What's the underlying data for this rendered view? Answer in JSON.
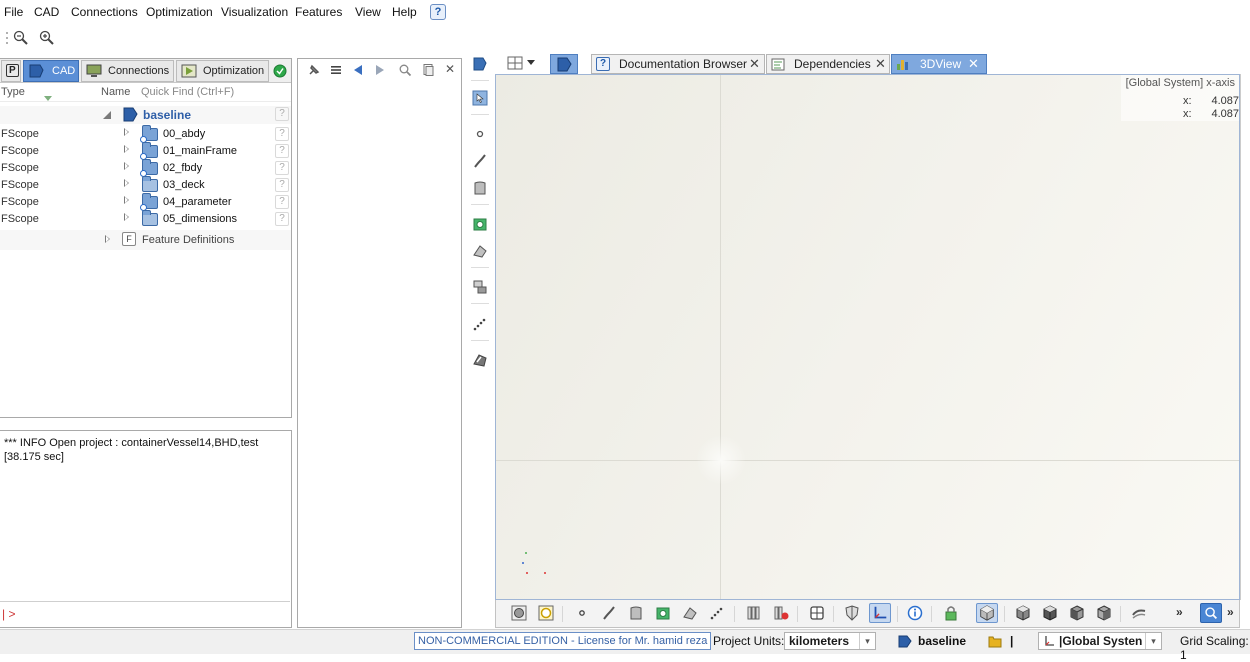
{
  "menu": [
    "File",
    "CAD",
    "Connections",
    "Optimization",
    "Visualization",
    "Features",
    "View",
    "Help"
  ],
  "help_icon_label": "?",
  "left_tabs": [
    {
      "label": "P"
    },
    {
      "label": "CAD"
    },
    {
      "label": "Connections"
    },
    {
      "label": "Optimization"
    }
  ],
  "tree_header": {
    "type": "Type",
    "name": "Name",
    "quick_find": "Quick Find (Ctrl+F)"
  },
  "tree": {
    "root": "baseline",
    "rows": [
      {
        "type": "FScope",
        "name": "00_abdy"
      },
      {
        "type": "FScope",
        "name": "01_mainFrame"
      },
      {
        "type": "FScope",
        "name": "02_fbdy"
      },
      {
        "type": "FScope",
        "name": "03_deck"
      },
      {
        "type": "FScope",
        "name": "04_parameter"
      },
      {
        "type": "FScope",
        "name": "05_dimensions"
      }
    ],
    "feature_definitions": "Feature Definitions",
    "feature_icon_label": "F",
    "qmark": "?"
  },
  "console": {
    "text": "*** INFO Open project : containerVessel14,BHD,test\n[38.175 sec]",
    "prompt": "| >"
  },
  "right_tabs": [
    {
      "label": "Documentation Browser"
    },
    {
      "label": "Dependencies"
    },
    {
      "label": "3DView"
    }
  ],
  "close_glyph": "✕",
  "viewport": {
    "coord_title": "[Global System] x-axis",
    "coords": [
      {
        "key": "x:",
        "value": "4.087"
      },
      {
        "key": "x:",
        "value": "4.087"
      }
    ]
  },
  "more_glyph": "»",
  "statusbar": {
    "license": "NON-COMMERCIAL EDITION - License for Mr. hamid reza",
    "project_units_label": "Project Units:",
    "project_units_value": "kilometers",
    "baseline": "baseline",
    "separator": "|",
    "coord_system": "|Global Systen",
    "grid_scaling": "Grid Scaling: 1",
    "dropdown_glyph": "▾"
  },
  "colors": {
    "accent": "#5b8fd6",
    "viewport_bg": "#f1f0ea",
    "license_text": "#3661a5"
  }
}
